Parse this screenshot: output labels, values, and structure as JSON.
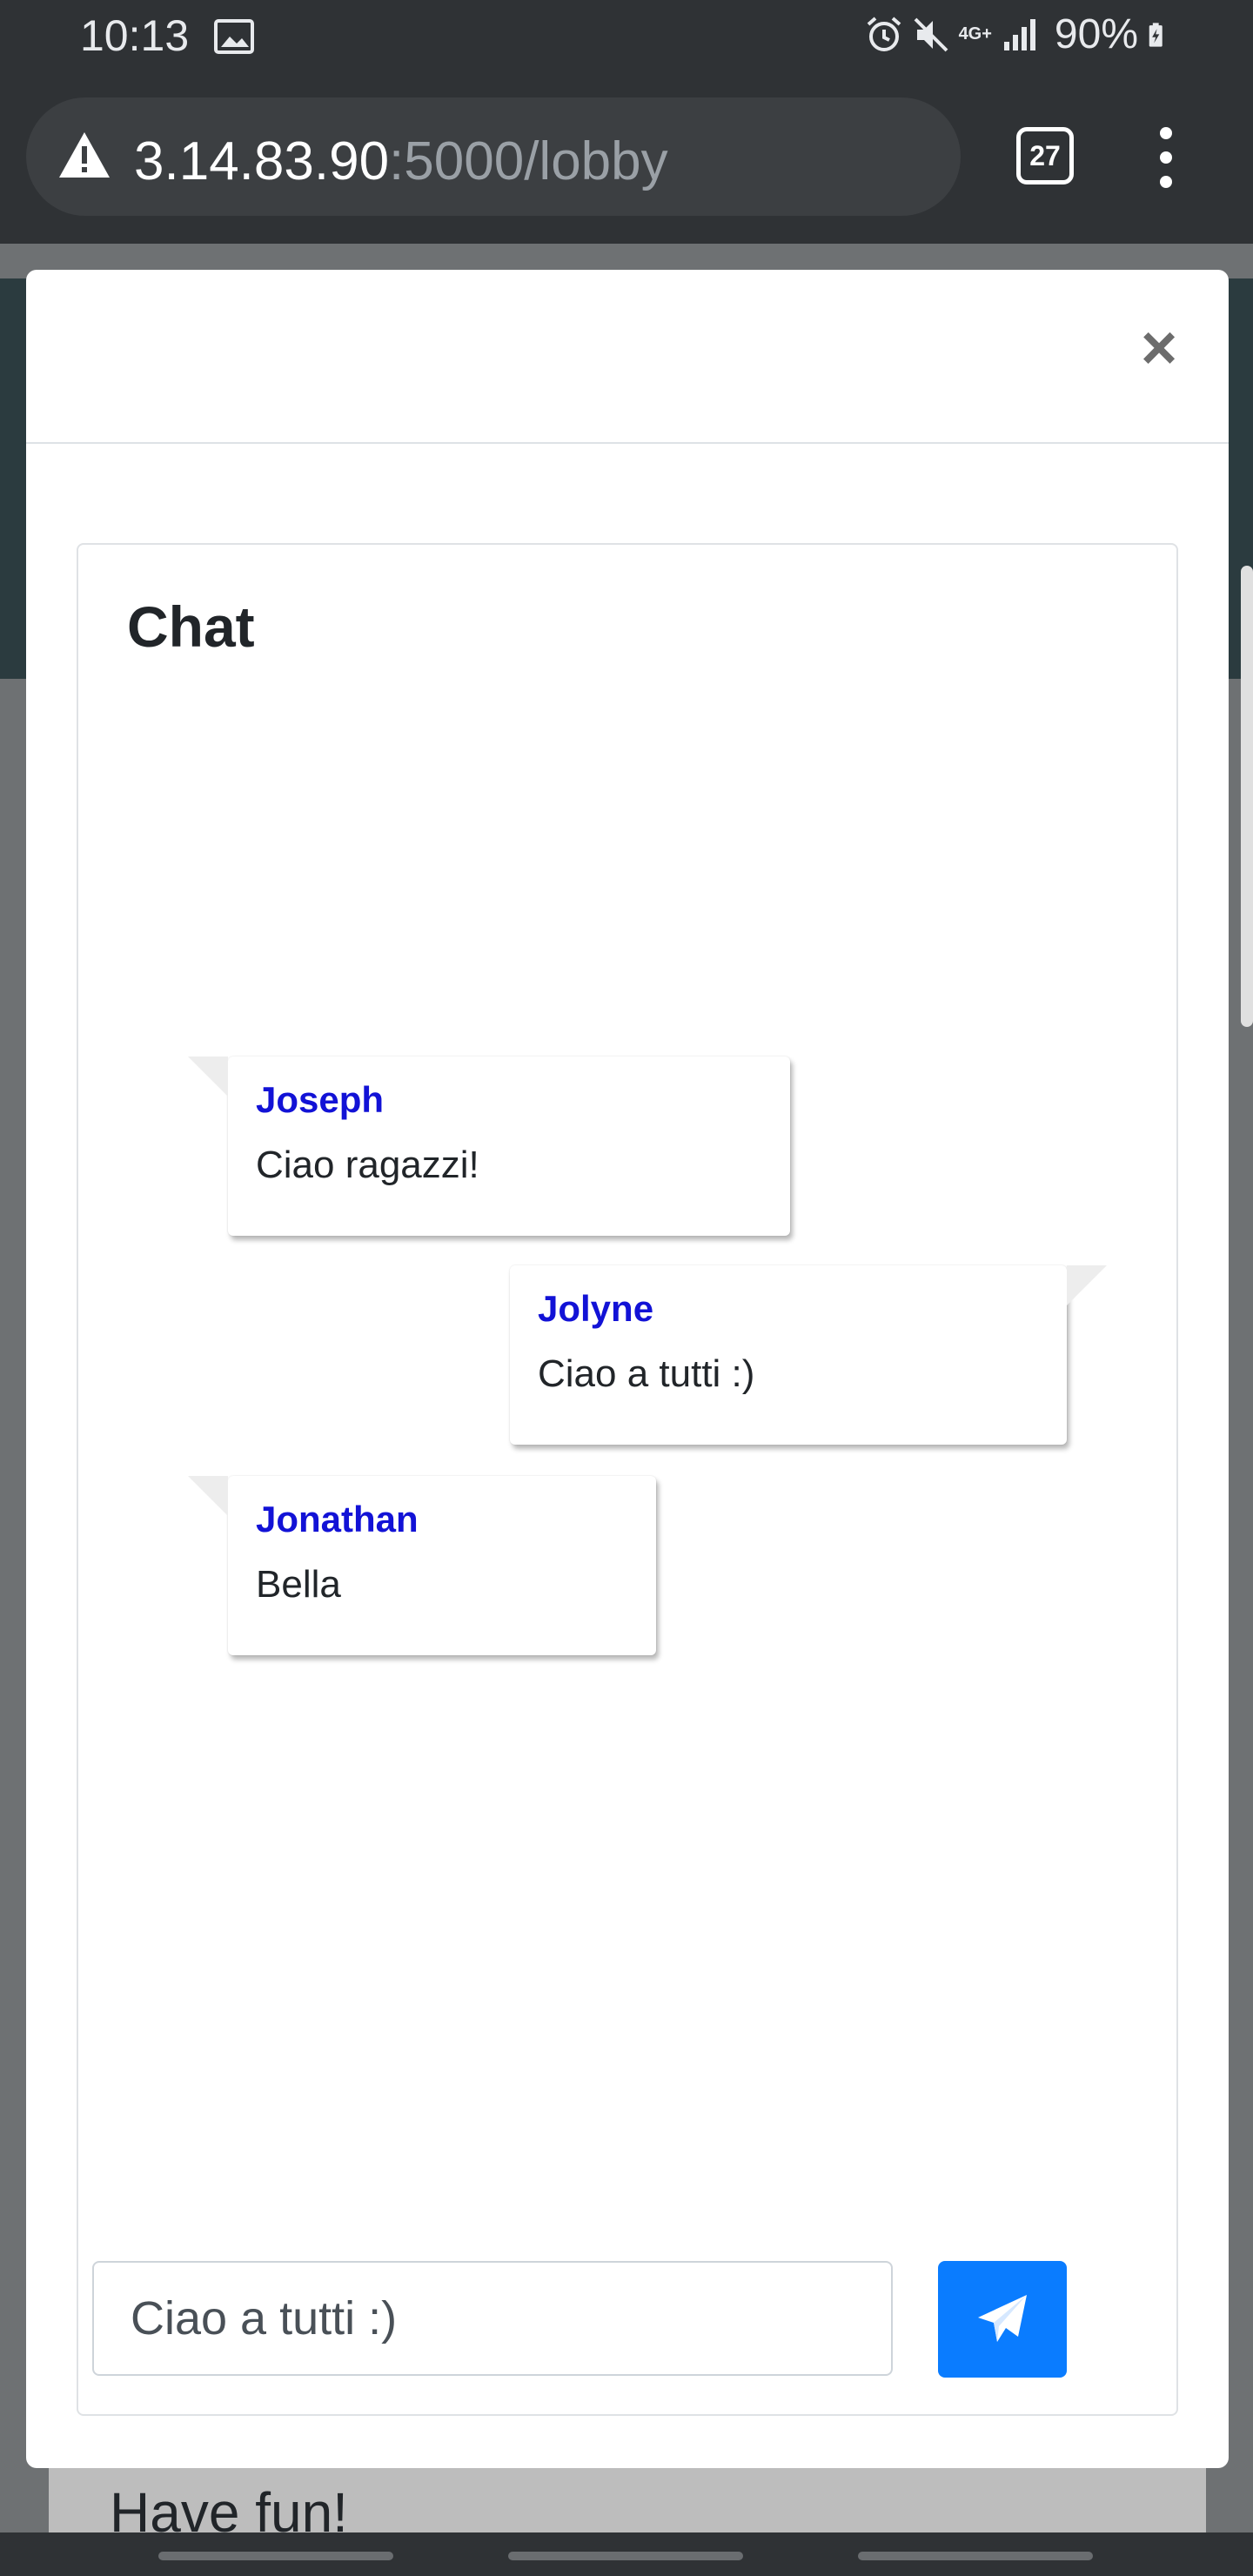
{
  "status_bar": {
    "time": "10:13",
    "network": "4G+",
    "battery": "90%"
  },
  "browser": {
    "url_host": "3.14.83.90",
    "url_path": ":5000/lobby",
    "tab_count": "27"
  },
  "modal": {
    "close_label": "×",
    "chat": {
      "title": "Chat",
      "messages": [
        {
          "name": "Joseph",
          "text": "Ciao ragazzi!"
        },
        {
          "name": "Jolyne",
          "text": "Ciao a tutti :)"
        },
        {
          "name": "Jonathan",
          "text": "Bella"
        }
      ],
      "input_value": "Ciao a tutti :)"
    }
  },
  "page_behind": {
    "partial_text": "Have fun!"
  },
  "colors": {
    "accent": "#0a7cff",
    "username": "#1212d6"
  }
}
